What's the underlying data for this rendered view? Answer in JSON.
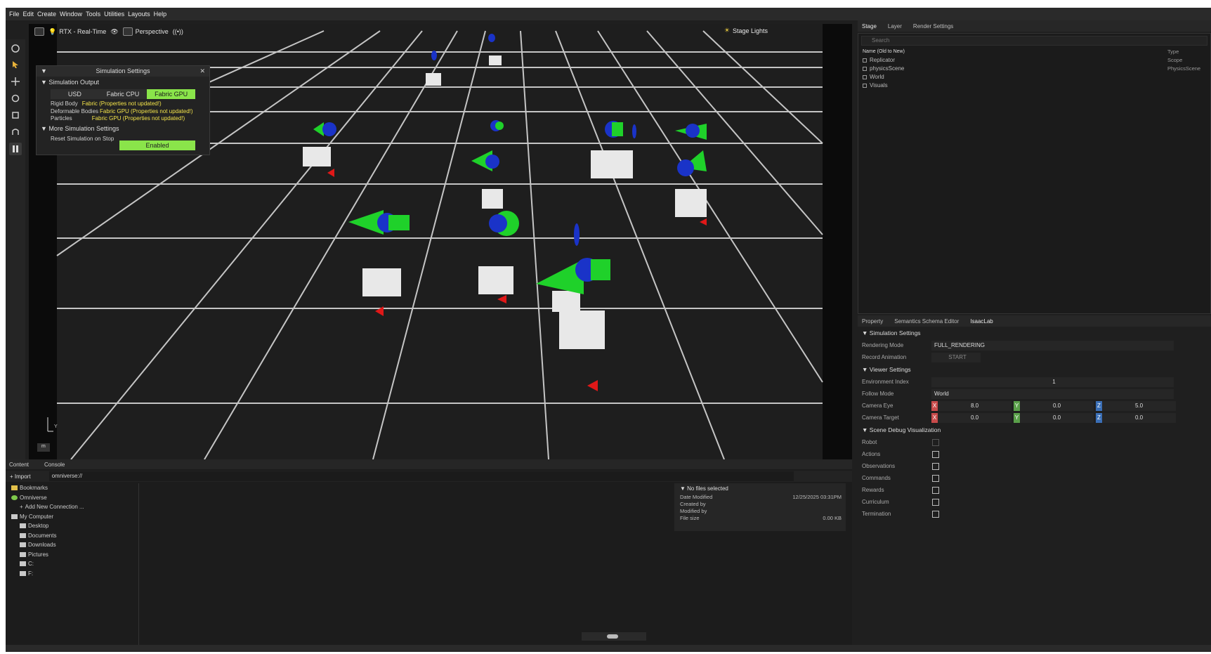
{
  "menu": [
    "File",
    "Edit",
    "Create",
    "Window",
    "Tools",
    "Utilities",
    "Layouts",
    "Help"
  ],
  "viewport": {
    "render_mode": "RTX - Real-Time",
    "camera": "Perspective",
    "audio_label": "((•))",
    "stage_lights": "Stage Lights",
    "axis_label_y": "Y",
    "axis_label_m": "m"
  },
  "sim_settings": {
    "title": "Simulation Settings",
    "close": "✕",
    "output_section": "Simulation Output",
    "modes": [
      "USD",
      "Fabric CPU",
      "Fabric GPU"
    ],
    "active_mode": "Fabric GPU",
    "rows": [
      {
        "key": "Rigid Body",
        "value": "Fabric (Properties not updated!)"
      },
      {
        "key": "Deformable Bodies",
        "value": "Fabric GPU (Properties not updated!)"
      },
      {
        "key": "Particles",
        "value": "Fabric GPU (Properties not updated!)"
      }
    ],
    "more_section": "More Simulation Settings",
    "reset_label": "Reset Simulation on Stop",
    "reset_value": "Enabled"
  },
  "stage": {
    "tabs": [
      "Stage",
      "Layer",
      "Render Settings"
    ],
    "search_placeholder": "Search",
    "col_name": "Name (Old to New)",
    "col_type": "Type",
    "items": [
      {
        "name": "Replicator",
        "type": "Scope"
      },
      {
        "name": "physicsScene",
        "type": "PhysicsScene"
      },
      {
        "name": "World",
        "type": ""
      },
      {
        "name": "Visuals",
        "type": ""
      }
    ]
  },
  "properties": {
    "tabs": [
      "Property",
      "Semantics Schema Editor",
      "IsaacLab"
    ],
    "sim_section": "Simulation Settings",
    "rendering_mode_label": "Rendering Mode",
    "rendering_mode_value": "FULL_RENDERING",
    "record_label": "Record Animation",
    "record_btn": "START",
    "viewer_section": "Viewer Settings",
    "env_index_label": "Environment Index",
    "env_index_value": "1",
    "follow_label": "Follow Mode",
    "follow_value": "World",
    "cam_eye_label": "Camera Eye",
    "cam_eye": [
      "8.0",
      "0.0",
      "5.0"
    ],
    "cam_target_label": "Camera Target",
    "cam_target": [
      "0.0",
      "0.0",
      "0.0"
    ],
    "debug_section": "Scene Debug Visualization",
    "debug_items": [
      "Robot",
      "Actions",
      "Observations",
      "Commands",
      "Rewards",
      "Curriculum",
      "Termination"
    ],
    "axis_tags": [
      "X",
      "Y",
      "Z"
    ],
    "axis_colors": [
      "#c94b4b",
      "#5aa04a",
      "#3b6fb6"
    ]
  },
  "content": {
    "tabs": [
      "Content",
      "Console"
    ],
    "import": "+ Import",
    "path": "omniverse://",
    "tree": [
      {
        "label": "Bookmarks",
        "indent": 0
      },
      {
        "label": "Omniverse",
        "indent": 0
      },
      {
        "label": "Add New Connection ...",
        "indent": 1
      },
      {
        "label": "My Computer",
        "indent": 0
      },
      {
        "label": "Desktop",
        "indent": 1
      },
      {
        "label": "Documents",
        "indent": 1
      },
      {
        "label": "Downloads",
        "indent": 1
      },
      {
        "label": "Pictures",
        "indent": 1
      },
      {
        "label": "C:",
        "indent": 1
      },
      {
        "label": "F:",
        "indent": 1
      }
    ],
    "details": {
      "header": "No files selected",
      "rows": [
        {
          "k": "Date Modified",
          "v": "12/25/2025 03:31PM"
        },
        {
          "k": "Created by",
          "v": ""
        },
        {
          "k": "Modified by",
          "v": ""
        },
        {
          "k": "File size",
          "v": "0.00 KB"
        }
      ]
    }
  }
}
